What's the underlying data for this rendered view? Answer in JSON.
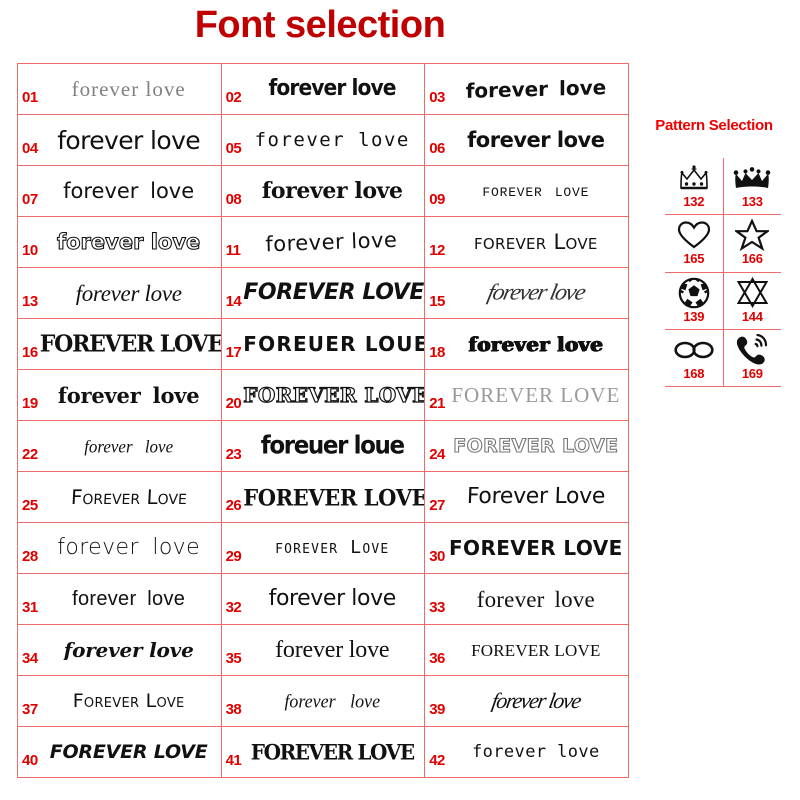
{
  "font_section": {
    "title": "Font selection",
    "title_color": "#c00000",
    "grid": {
      "columns": 3,
      "rows": 14
    },
    "items": [
      {
        "id": "01",
        "text": "forever  love"
      },
      {
        "id": "02",
        "text": "forever love"
      },
      {
        "id": "03",
        "text": "forever love"
      },
      {
        "id": "04",
        "text": "forever love"
      },
      {
        "id": "05",
        "text": "forever love"
      },
      {
        "id": "06",
        "text": "forever love"
      },
      {
        "id": "07",
        "text": "forever love"
      },
      {
        "id": "08",
        "text": "forever love"
      },
      {
        "id": "09",
        "text": "forever love"
      },
      {
        "id": "10",
        "text": "forever love"
      },
      {
        "id": "11",
        "text": "forever love"
      },
      {
        "id": "12",
        "text": "forever Love"
      },
      {
        "id": "13",
        "text": "forever love"
      },
      {
        "id": "14",
        "text": "FOREVER LOVE"
      },
      {
        "id": "15",
        "text": "forever love"
      },
      {
        "id": "16",
        "text": "FOREVER LOVE"
      },
      {
        "id": "17",
        "text": "FOREUER LOUE"
      },
      {
        "id": "18",
        "text": "forever love"
      },
      {
        "id": "19",
        "text": "forever  love"
      },
      {
        "id": "20",
        "text": "FOREVER LOVE"
      },
      {
        "id": "21",
        "text": "FOREVER LOVE"
      },
      {
        "id": "22",
        "text": "forever  love"
      },
      {
        "id": "23",
        "text": "foreuer loue"
      },
      {
        "id": "24",
        "text": "FOREVER LOVE"
      },
      {
        "id": "25",
        "text": "Forever Love"
      },
      {
        "id": "26",
        "text": "FOREVER LOVE"
      },
      {
        "id": "27",
        "text": "Forever Love"
      },
      {
        "id": "28",
        "text": "forever  love"
      },
      {
        "id": "29",
        "text": "forever Love"
      },
      {
        "id": "30",
        "text": "FOREVER LOVE"
      },
      {
        "id": "31",
        "text": "forever  love"
      },
      {
        "id": "32",
        "text": "forever love"
      },
      {
        "id": "33",
        "text": "forever  love"
      },
      {
        "id": "34",
        "text": "forever love"
      },
      {
        "id": "35",
        "text": "forever love"
      },
      {
        "id": "36",
        "text": "FOREVER LOVE"
      },
      {
        "id": "37",
        "text": "Forever Love"
      },
      {
        "id": "38",
        "text": "forever  love"
      },
      {
        "id": "39",
        "text": "forever love"
      },
      {
        "id": "40",
        "text": "FOREVER LOVE"
      },
      {
        "id": "41",
        "text": "FOREVER LOVE"
      },
      {
        "id": "42",
        "text": "forever love"
      }
    ]
  },
  "pattern_section": {
    "title": "Pattern Selection",
    "title_color": "#ee0000",
    "grid": {
      "columns": 2,
      "rows": 4
    },
    "items": [
      {
        "id": "132",
        "icon": "crown-outline-icon"
      },
      {
        "id": "133",
        "icon": "crown-filled-icon"
      },
      {
        "id": "165",
        "icon": "heart-outline-icon"
      },
      {
        "id": "166",
        "icon": "star-outline-icon"
      },
      {
        "id": "139",
        "icon": "soccer-ball-icon"
      },
      {
        "id": "144",
        "icon": "star-of-david-icon"
      },
      {
        "id": "168",
        "icon": "infinity-icon"
      },
      {
        "id": "169",
        "icon": "phone-ringing-icon"
      }
    ]
  },
  "colors": {
    "grid_line": "#f26b6b",
    "index_number": "#e00000",
    "sample_text": "#111111",
    "background": "#ffffff"
  }
}
